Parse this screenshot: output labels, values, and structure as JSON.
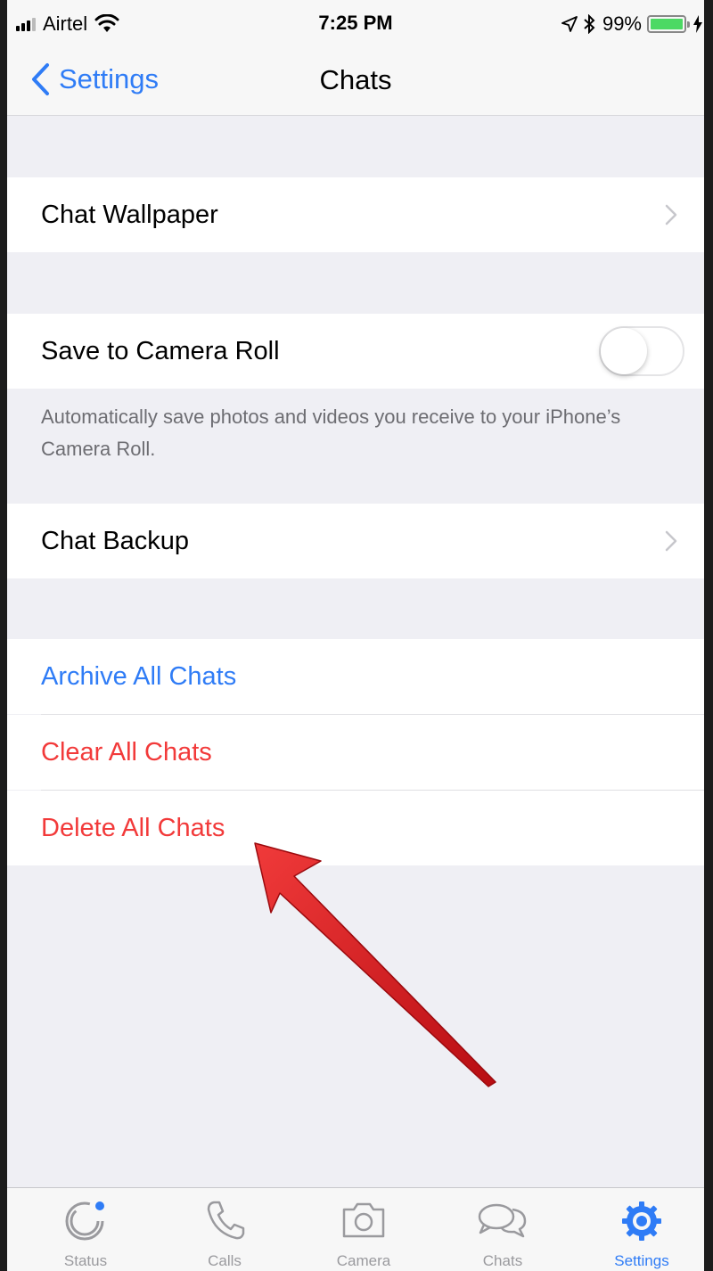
{
  "status_bar": {
    "carrier": "Airtel",
    "time": "7:25 PM",
    "battery_percent": "99%",
    "battery_level": 0.99
  },
  "nav": {
    "back_label": "Settings",
    "title": "Chats"
  },
  "settings": {
    "chat_wallpaper": "Chat Wallpaper",
    "save_to_camera_roll": "Save to Camera Roll",
    "save_to_camera_roll_on": false,
    "camera_roll_note": "Automatically save photos and videos you receive to your iPhone’s Camera Roll.",
    "chat_backup": "Chat Backup",
    "archive_all": "Archive All Chats",
    "clear_all": "Clear All Chats",
    "delete_all": "Delete All Chats"
  },
  "tabs": [
    {
      "label": "Status",
      "icon": "status-icon"
    },
    {
      "label": "Calls",
      "icon": "phone-icon"
    },
    {
      "label": "Camera",
      "icon": "camera-icon"
    },
    {
      "label": "Chats",
      "icon": "chat-bubbles-icon"
    },
    {
      "label": "Settings",
      "icon": "gear-icon",
      "active": true
    }
  ],
  "colors": {
    "accent_blue": "#2f7cf6",
    "destructive_red": "#f23a3a",
    "annotation_arrow": "#d9151b"
  }
}
